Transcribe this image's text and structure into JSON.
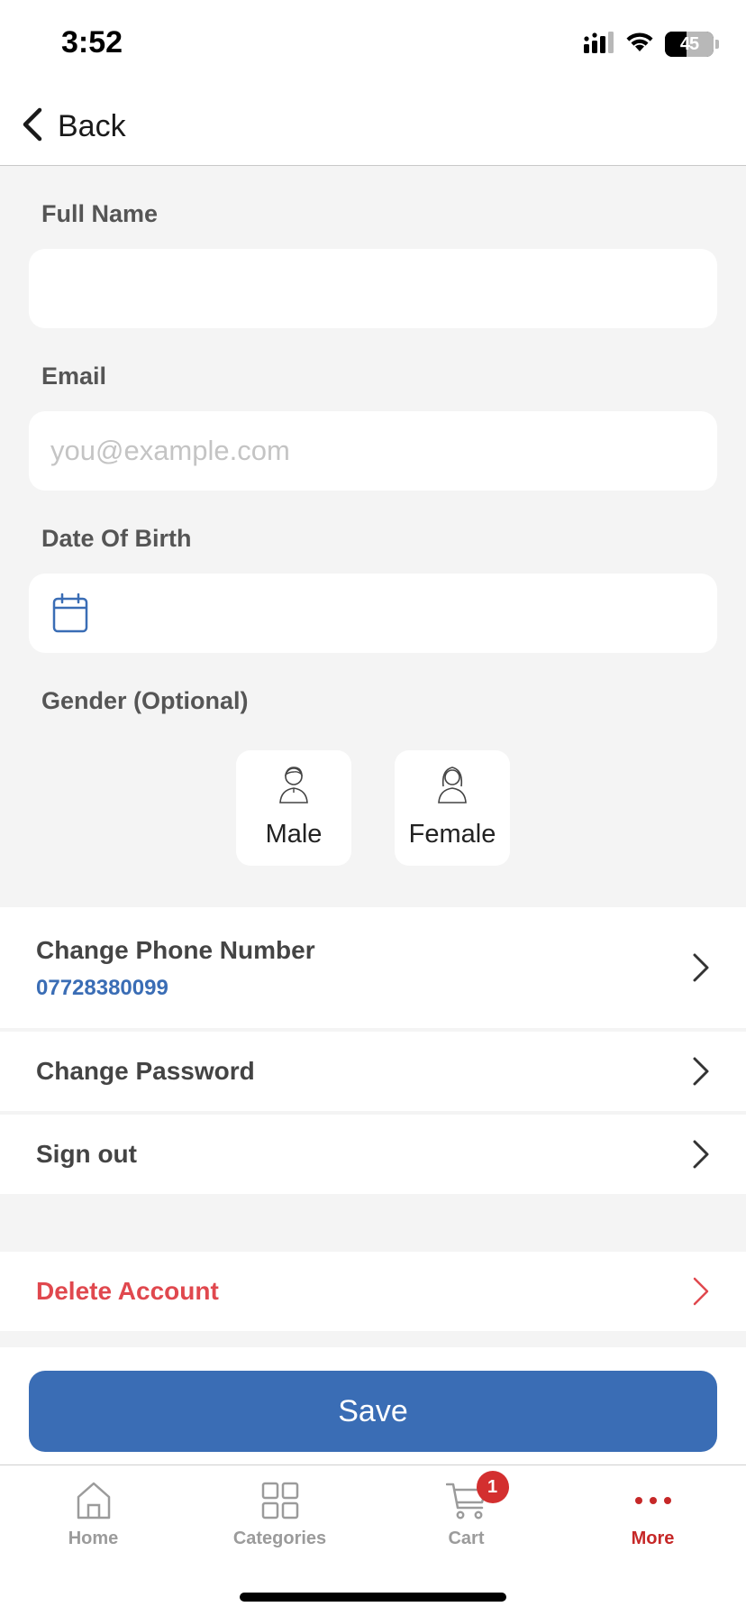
{
  "status_bar": {
    "time": "3:52",
    "battery_level": "45"
  },
  "nav": {
    "back_label": "Back"
  },
  "form": {
    "full_name_label": "Full Name",
    "full_name_value": "",
    "email_label": "Email",
    "email_placeholder": "you@example.com",
    "dob_label": "Date Of Birth",
    "dob_value": "",
    "gender_label": "Gender (Optional)",
    "gender_options": [
      "Male",
      "Female"
    ]
  },
  "settings": {
    "change_phone_label": "Change Phone Number",
    "phone_number": "07728380099",
    "change_password_label": "Change Password",
    "sign_out_label": "Sign out",
    "delete_account_label": "Delete Account"
  },
  "actions": {
    "save_label": "Save"
  },
  "tab_bar": {
    "tabs": [
      {
        "label": "Home",
        "icon": "home-icon"
      },
      {
        "label": "Categories",
        "icon": "grid-icon"
      },
      {
        "label": "Cart",
        "icon": "cart-icon",
        "badge": "1"
      },
      {
        "label": "More",
        "icon": "more-icon",
        "active": true
      }
    ]
  },
  "colors": {
    "accent_blue": "#3a6db5",
    "danger_red": "#e0484e",
    "active_tab_red": "#c62828",
    "badge_red": "#d32f2f",
    "background": "#f4f4f4"
  }
}
